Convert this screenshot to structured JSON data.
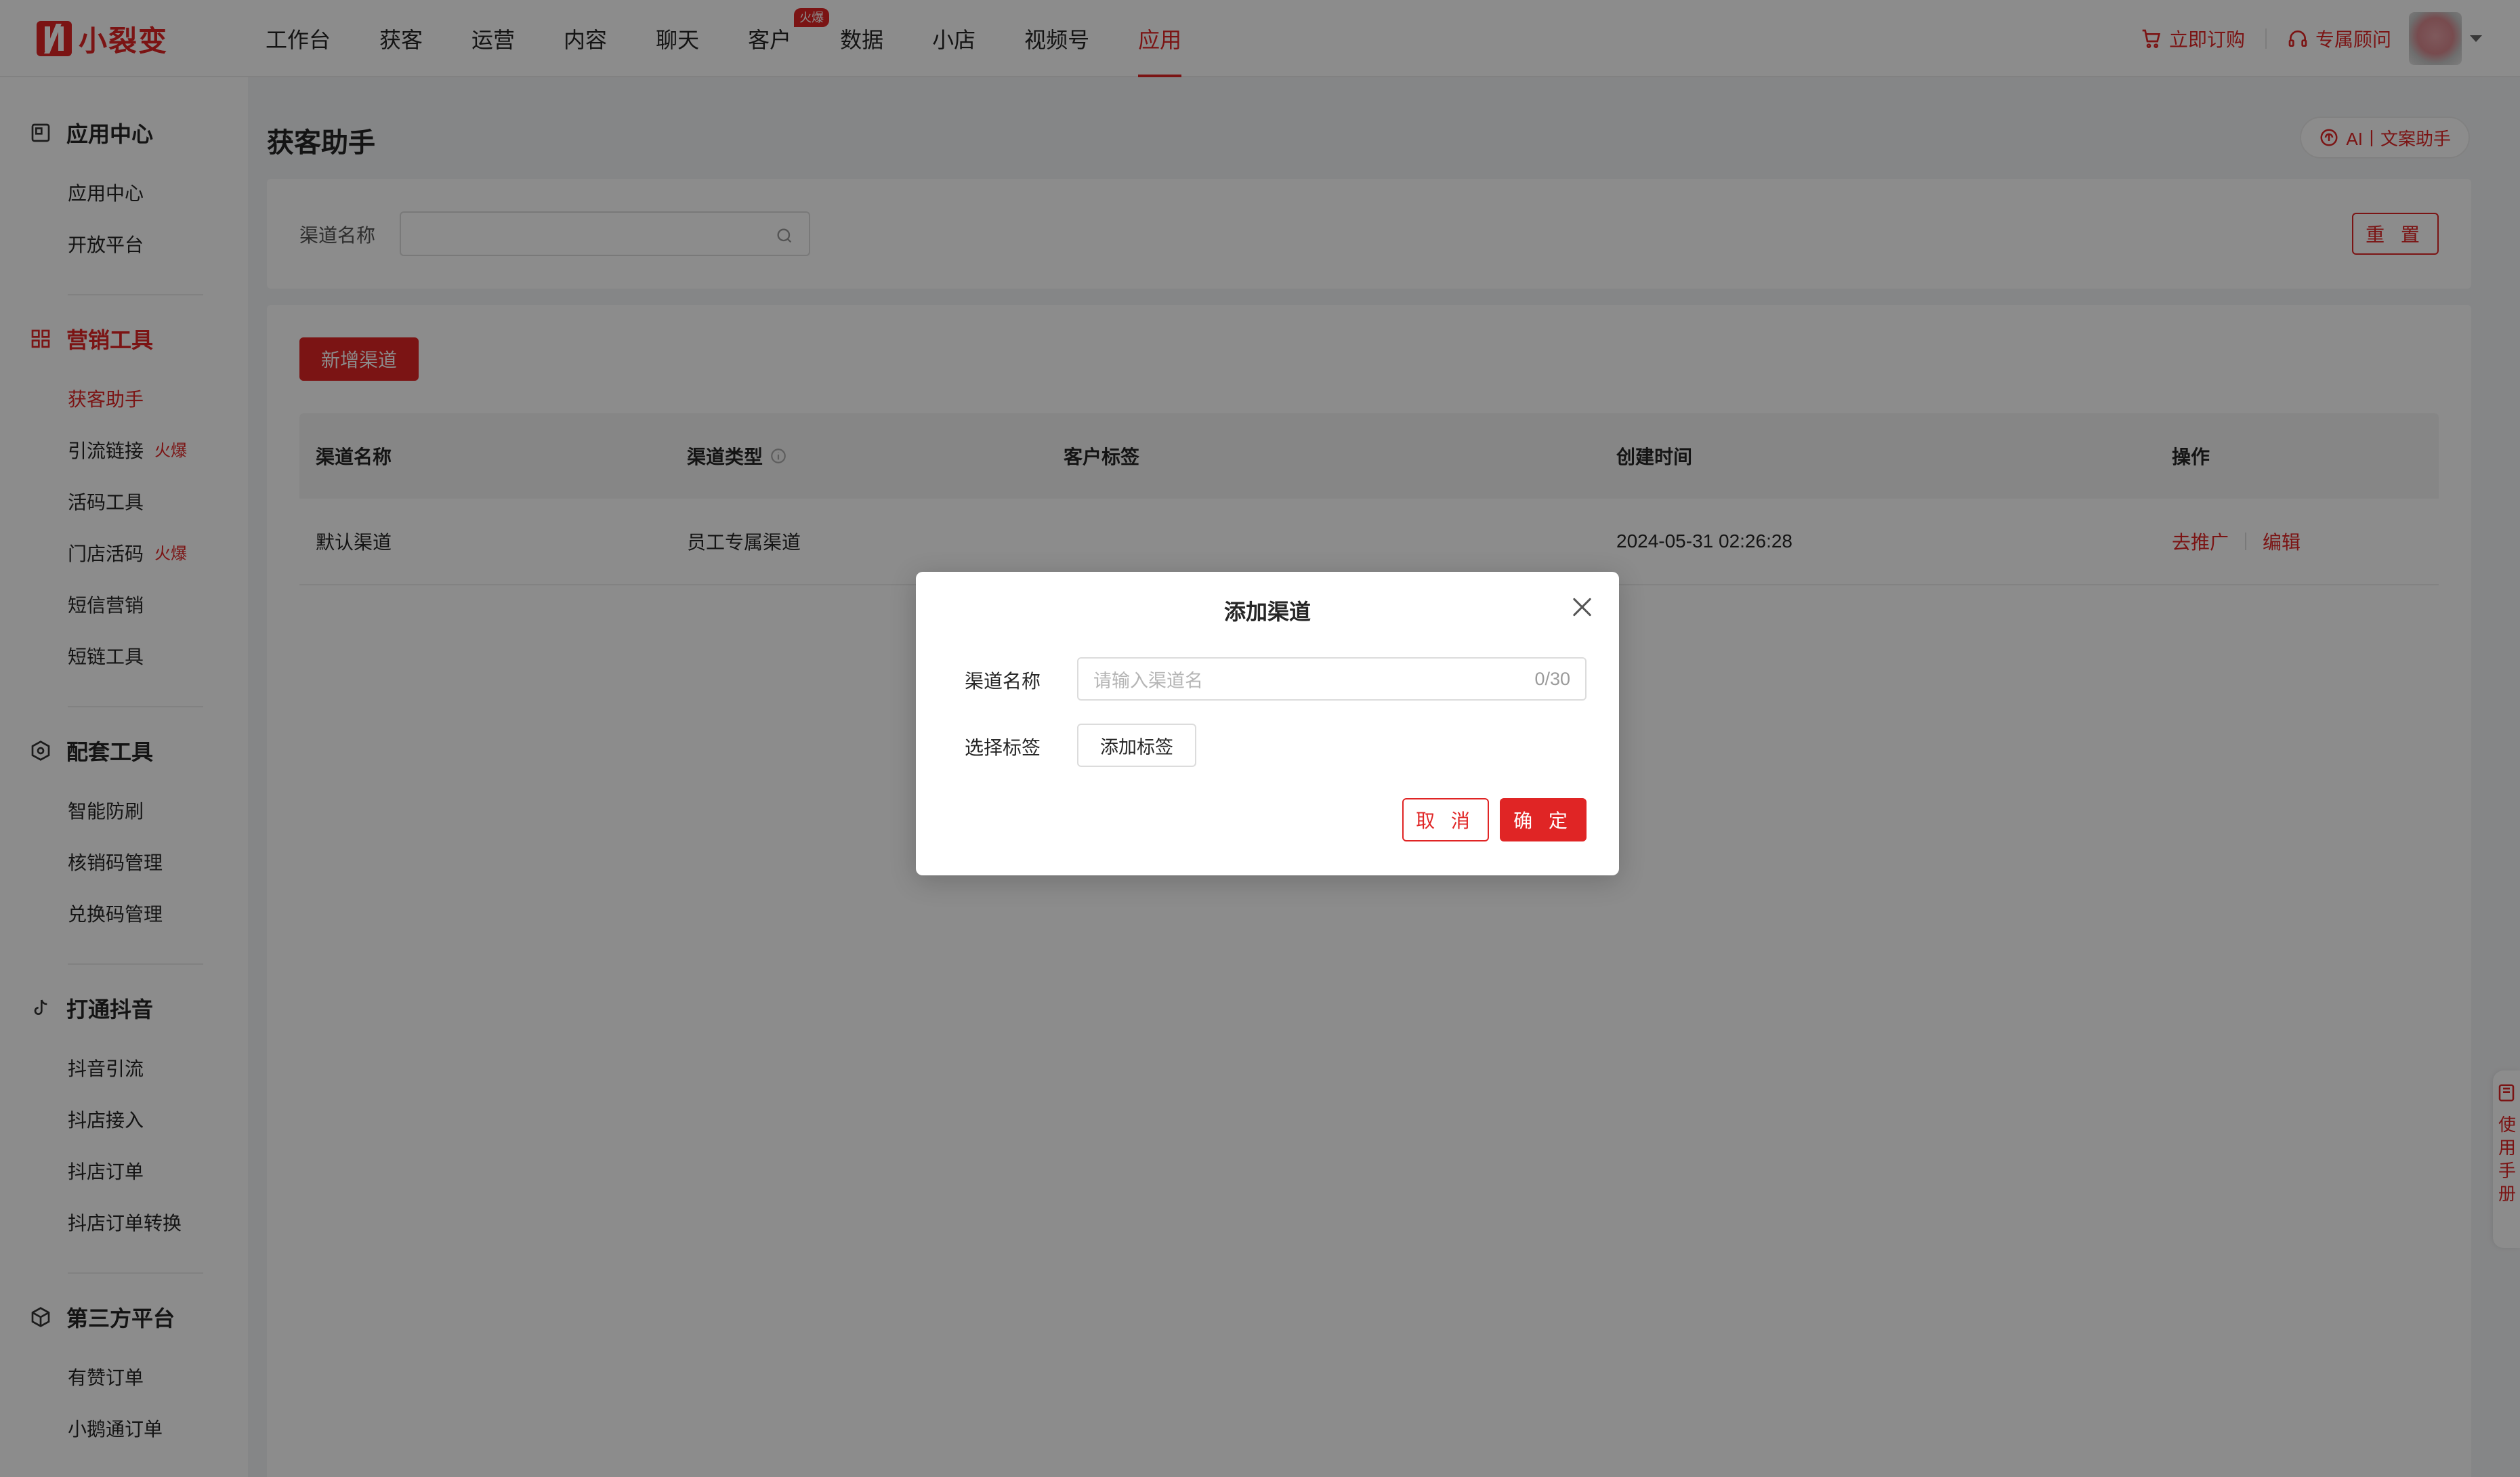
{
  "brand": {
    "name": "小裂变",
    "color": "#e02525"
  },
  "nav": {
    "items": [
      {
        "label": "工作台"
      },
      {
        "label": "获客"
      },
      {
        "label": "运营"
      },
      {
        "label": "内容"
      },
      {
        "label": "聊天"
      },
      {
        "label": "客户",
        "badge": "火爆"
      },
      {
        "label": "数据"
      },
      {
        "label": "小店"
      },
      {
        "label": "视频号"
      },
      {
        "label": "应用",
        "active": true
      }
    ],
    "order_label": "立即订购",
    "advisor_label": "专属顾问"
  },
  "sidebar": {
    "groups": [
      {
        "title": "应用中心",
        "icon": "app-center-icon",
        "items": [
          {
            "label": "应用中心"
          },
          {
            "label": "开放平台"
          }
        ]
      },
      {
        "title": "营销工具",
        "icon": "grid-icon",
        "items": [
          {
            "label": "获客助手"
          },
          {
            "label": "引流链接",
            "hot": "火爆"
          },
          {
            "label": "活码工具"
          },
          {
            "label": "门店活码",
            "hot": "火爆"
          },
          {
            "label": "短信营销"
          },
          {
            "label": "短链工具"
          }
        ]
      },
      {
        "title": "配套工具",
        "icon": "hexagon-gear-icon",
        "items": [
          {
            "label": "智能防刷"
          },
          {
            "label": "核销码管理"
          },
          {
            "label": "兑换码管理"
          }
        ]
      },
      {
        "title": "打通抖音",
        "icon": "tiktok-icon",
        "items": [
          {
            "label": "抖音引流"
          },
          {
            "label": "抖店接入"
          },
          {
            "label": "抖店订单"
          },
          {
            "label": "抖店订单转换"
          }
        ]
      },
      {
        "title": "第三方平台",
        "icon": "cube-icon",
        "items": [
          {
            "label": "有赞订单"
          },
          {
            "label": "小鹅通订单"
          }
        ]
      }
    ]
  },
  "main": {
    "title": "获客助手",
    "ai_label": "AI丨文案助手",
    "filter": {
      "label": "渠道名称",
      "value": "",
      "reset_label": "重 置"
    },
    "add_label": "新增渠道",
    "table": {
      "headers": {
        "name": "渠道名称",
        "type": "渠道类型",
        "tags": "客户标签",
        "created": "创建时间",
        "ops": "操作"
      },
      "rows": [
        {
          "name": "默认渠道",
          "type": "员工专属渠道",
          "tags": "",
          "created": "2024-05-31 02:26:28",
          "promote": "去推广",
          "edit": "编辑"
        }
      ]
    }
  },
  "float_help": {
    "label": "使用手册"
  },
  "modal": {
    "title": "添加渠道",
    "name_label": "渠道名称",
    "name_placeholder": "请输入渠道名",
    "name_count": "0/30",
    "tag_label": "选择标签",
    "tag_button": "添加标签",
    "cancel": "取 消",
    "confirm": "确 定"
  }
}
